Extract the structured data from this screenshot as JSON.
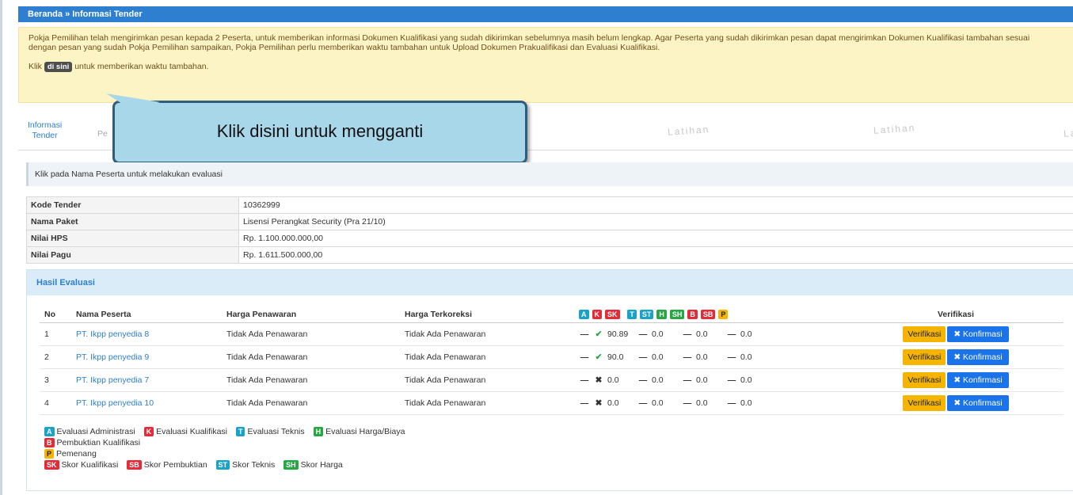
{
  "breadcrumb": "Beranda » Informasi Tender",
  "alert": {
    "message": "Pokja Pemilihan telah mengirimkan pesan kepada 2 Peserta, untuk memberikan informasi Dokumen Kualifikasi yang sudah dikirimkan sebelumnya masih belum lengkap. Agar Peserta yang sudah dikirimkan pesan dapat mengirimkan Dokumen Kualifikasi tambahan sesuai dengan pesan yang sudah Pokja Pemilihan sampaikan, Pokja Pemilihan perlu memberikan waktu tambahan untuk Upload Dokumen Prakualifikasi dan Evaluasi Kualifikasi.",
    "klik_prefix": "Klik",
    "link_label": "di sini",
    "klik_suffix": "untuk memberikan waktu tambahan."
  },
  "tabs": {
    "active_line1": "Informasi",
    "active_line2": "Tender",
    "ghost": "Pe",
    "watermark": "Latihan"
  },
  "callout": "Klik disini untuk mengganti",
  "info_strip": "Klik pada Nama Peserta untuk melakukan evaluasi",
  "info": [
    {
      "label": "Kode Tender",
      "value": "10362999"
    },
    {
      "label": "Nama Paket",
      "value": "Lisensi Perangkat Security (Pra 21/10)"
    },
    {
      "label": "Nilai HPS",
      "value": "Rp. 1.100.000.000,00"
    },
    {
      "label": "Nilai Pagu",
      "value": "Rp. 1.611.500.000,00"
    }
  ],
  "panel_title": "Hasil Evaluasi",
  "columns": {
    "no": "No",
    "nama": "Nama Peserta",
    "harga": "Harga Penawaran",
    "terkoreksi": "Harga Terkoreksi",
    "verifikasi": "Verifikasi",
    "badges": [
      "A",
      "K",
      "SK",
      "T",
      "ST",
      "H",
      "SH",
      "B",
      "SB",
      "P"
    ]
  },
  "rows": [
    {
      "no": "1",
      "nama": "PT. Ikpp penyedia 8",
      "harga": "Tidak Ada Penawaran",
      "terkoreksi": "Tidak Ada Penawaran",
      "a": "—",
      "k": "✔",
      "sk": "90.89",
      "t": "—",
      "st": "0.0",
      "h": "—",
      "sh": "0.0",
      "b": "—",
      "sb": "0.0"
    },
    {
      "no": "2",
      "nama": "PT. Ikpp penyedia 9",
      "harga": "Tidak Ada Penawaran",
      "terkoreksi": "Tidak Ada Penawaran",
      "a": "—",
      "k": "✔",
      "sk": "90.0",
      "t": "—",
      "st": "0.0",
      "h": "—",
      "sh": "0.0",
      "b": "—",
      "sb": "0.0"
    },
    {
      "no": "3",
      "nama": "PT. Ikpp penyedia 7",
      "harga": "Tidak Ada Penawaran",
      "terkoreksi": "Tidak Ada Penawaran",
      "a": "—",
      "k": "✖",
      "sk": "0.0",
      "t": "—",
      "st": "0.0",
      "h": "—",
      "sh": "0.0",
      "b": "—",
      "sb": "0.0"
    },
    {
      "no": "4",
      "nama": "PT. Ikpp penyedia 10",
      "harga": "Tidak Ada Penawaran",
      "terkoreksi": "Tidak Ada Penawaran",
      "a": "—",
      "k": "✖",
      "sk": "0.0",
      "t": "—",
      "st": "0.0",
      "h": "—",
      "sh": "0.0",
      "b": "—",
      "sb": "0.0"
    }
  ],
  "buttons": {
    "verifikasi": "Verifikasi",
    "konfirmasi": "✖ Konfirmasi"
  },
  "legend": {
    "A": "Evaluasi Administrasi",
    "K": "Evaluasi Kualifikasi",
    "T": "Evaluasi Teknis",
    "H": "Evaluasi Harga/Biaya",
    "B": "Pembuktian Kualifikasi",
    "P": "Pemenang",
    "SK": "Skor Kualifikasi",
    "SB": "Skor Pembuktian",
    "ST": "Skor Teknis",
    "SH": "Skor Harga"
  }
}
